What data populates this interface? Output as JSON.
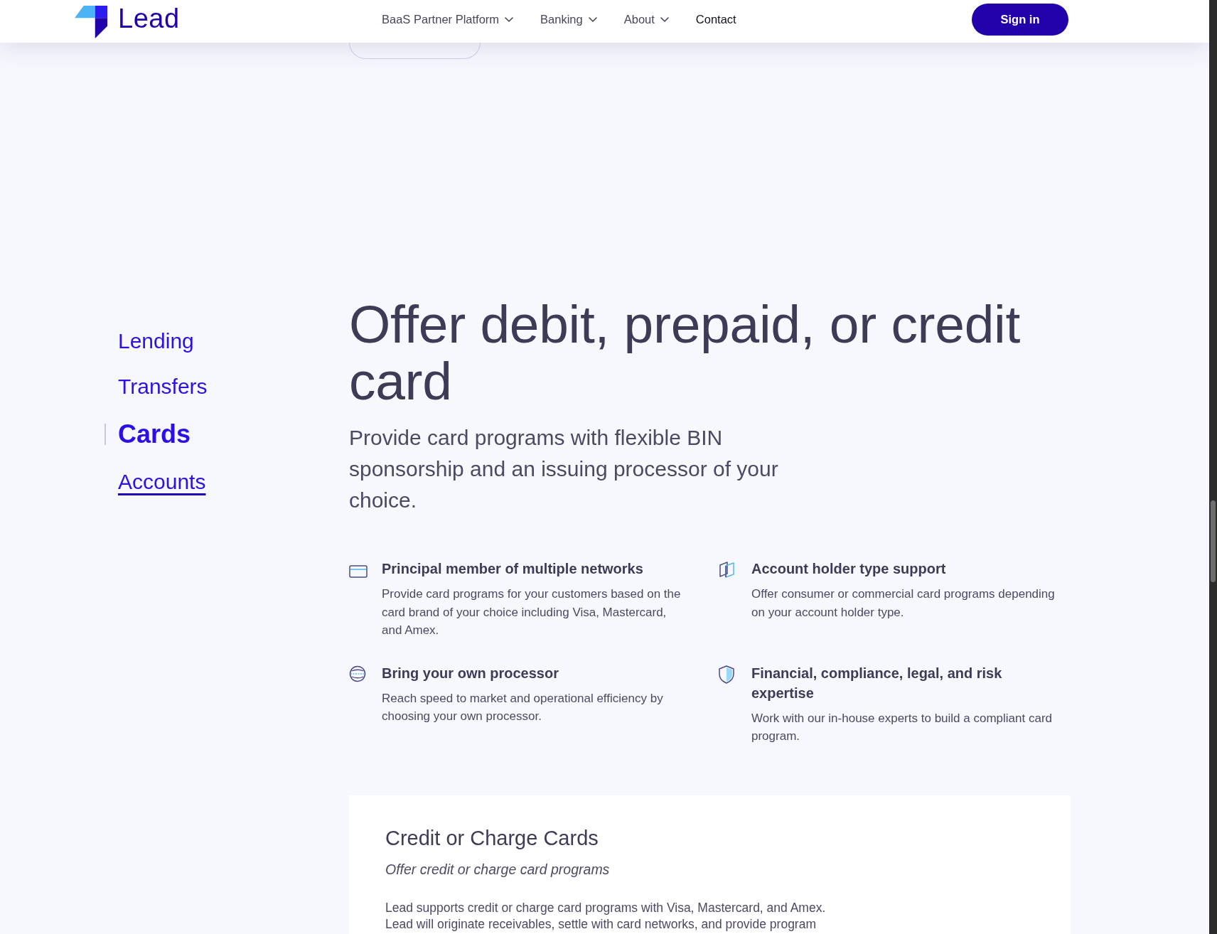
{
  "header": {
    "logo_text": "Lead",
    "nav": [
      {
        "label": "BaaS Partner Platform",
        "kind": "menu"
      },
      {
        "label": "Banking",
        "kind": "menu"
      },
      {
        "label": "About",
        "kind": "menu"
      },
      {
        "label": "Contact",
        "kind": "link"
      }
    ],
    "sign_in": "Sign in"
  },
  "sidebar": {
    "items": [
      {
        "label": "Lending",
        "selected": false,
        "hovered": false
      },
      {
        "label": "Transfers",
        "selected": false,
        "hovered": false
      },
      {
        "label": "Cards",
        "selected": true,
        "hovered": false
      },
      {
        "label": "Accounts",
        "selected": false,
        "hovered": true
      }
    ]
  },
  "hero": {
    "title": "Offer debit, prepaid, or credit card",
    "subtitle": "Provide card programs with flexible BIN sponsorship and an issuing processor of your choice."
  },
  "features": [
    {
      "title": "Principal member of multiple networks",
      "description": "Provide card programs for your customers based on the card brand of your choice including Visa, Mastercard, and Amex."
    },
    {
      "title": "Account holder type support",
      "description": "Offer consumer or commercial card programs depending on your account holder type."
    },
    {
      "title": "Bring your own processor",
      "description": "Reach speed to market and operational efficiency by choosing your own processor."
    },
    {
      "title": "Financial, compliance, legal, and risk expertise",
      "description": "Work with our in-house experts to build a compliant card program."
    }
  ],
  "card": {
    "title": "Credit or Charge Cards",
    "subtitle": "Offer credit or charge card programs",
    "body": "Lead supports credit or charge card programs with Visa, Mastercard, and Amex. Lead will originate receivables, settle with card networks, and provide program"
  }
}
